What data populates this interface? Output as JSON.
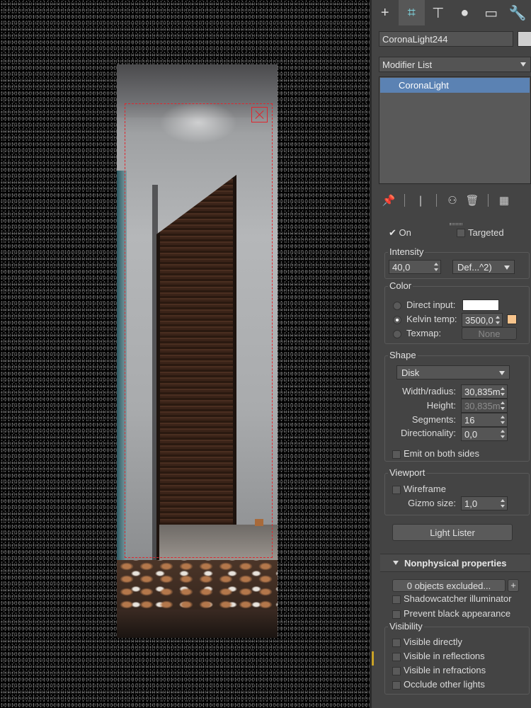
{
  "viewport": {
    "render_name": "viewport-render"
  },
  "panel": {
    "command_tabs": [
      {
        "name": "create",
        "glyph": "+"
      },
      {
        "name": "modify",
        "glyph": "⌗"
      },
      {
        "name": "hierarchy",
        "glyph": "⊤"
      },
      {
        "name": "motion",
        "glyph": "●"
      },
      {
        "name": "display",
        "glyph": "▭"
      },
      {
        "name": "utilities",
        "glyph": "🔧"
      }
    ],
    "object_name": "CoronaLight244",
    "modifier_list_label": "Modifier List",
    "stack_item": "CoronaLight",
    "stack_tools": {
      "pin": "📌",
      "show_end": "❘",
      "make_unique": "⚇",
      "remove": "🗑",
      "configure": "▦"
    }
  },
  "params": {
    "on_label": "On",
    "on_checked": true,
    "targeted_label": "Targeted",
    "intensity": {
      "title": "Intensity",
      "value": "40,0",
      "unit": "Def...^2)"
    },
    "color": {
      "title": "Color",
      "direct_input": "Direct input:",
      "direct_color": "#ffffff",
      "kelvin_label": "Kelvin temp:",
      "kelvin_value": "3500,0",
      "kelvin_color": "#f7c48c",
      "texmap_label": "Texmap:",
      "texmap_value": "None"
    },
    "shape": {
      "title": "Shape",
      "type": "Disk",
      "width_label": "Width/radius:",
      "width_value": "30,835m",
      "height_label": "Height:",
      "height_value": "30,835m",
      "segments_label": "Segments:",
      "segments_value": "16",
      "directionality_label": "Directionality:",
      "directionality_value": "0,0",
      "emit_both": "Emit on both sides"
    },
    "viewport": {
      "title": "Viewport",
      "wireframe": "Wireframe",
      "gizmo_label": "Gizmo size:",
      "gizmo_value": "1,0"
    },
    "light_lister": "Light Lister",
    "nonphysical": {
      "title": "Nonphysical properties",
      "excluded": "0 objects excluded...",
      "add": "+",
      "shadowcatcher": "Shadowcatcher illuminator",
      "prevent_black": "Prevent black appearance"
    },
    "visibility": {
      "title": "Visibility",
      "directly": "Visible directly",
      "reflections": "Visible in reflections",
      "refractions": "Visible in refractions",
      "occlude": "Occlude other lights"
    }
  }
}
